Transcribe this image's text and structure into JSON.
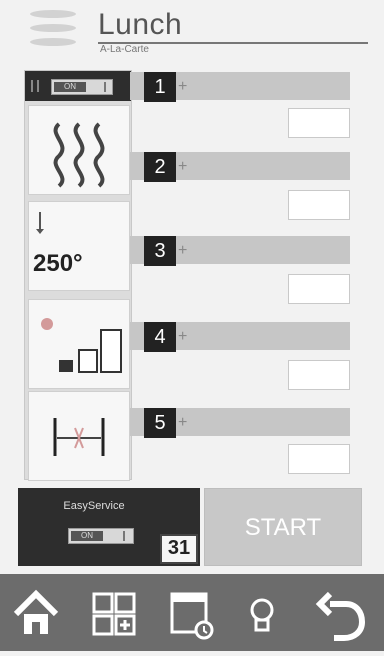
{
  "header": {
    "title": "Lunch",
    "subtitle": "A-La-Carte"
  },
  "left_panel": {
    "toggle_state": "ON",
    "temperature": "250°",
    "icons": [
      "heat-icon",
      "thermometer-icon",
      "fan-level-icon",
      "rack-icon"
    ]
  },
  "slots": [
    {
      "label": "1",
      "plus": "+",
      "value": ""
    },
    {
      "label": "2",
      "plus": "+",
      "value": ""
    },
    {
      "label": "3",
      "plus": "+",
      "value": ""
    },
    {
      "label": "4",
      "plus": "+",
      "value": ""
    },
    {
      "label": "5",
      "plus": "+",
      "value": ""
    }
  ],
  "easy_service": {
    "label": "EasyService",
    "toggle_state": "ON",
    "calendar_day": "31"
  },
  "start_label": "START",
  "footer": {
    "buttons": [
      "home-icon",
      "grid-add-icon",
      "calendar-schedule-icon",
      "bulb-icon",
      "undo-icon"
    ]
  },
  "colors": {
    "dark": "#2d2d2d",
    "bar": "#c6c6c6",
    "footer": "#6c6c6c",
    "start": "#c8c8c8"
  }
}
